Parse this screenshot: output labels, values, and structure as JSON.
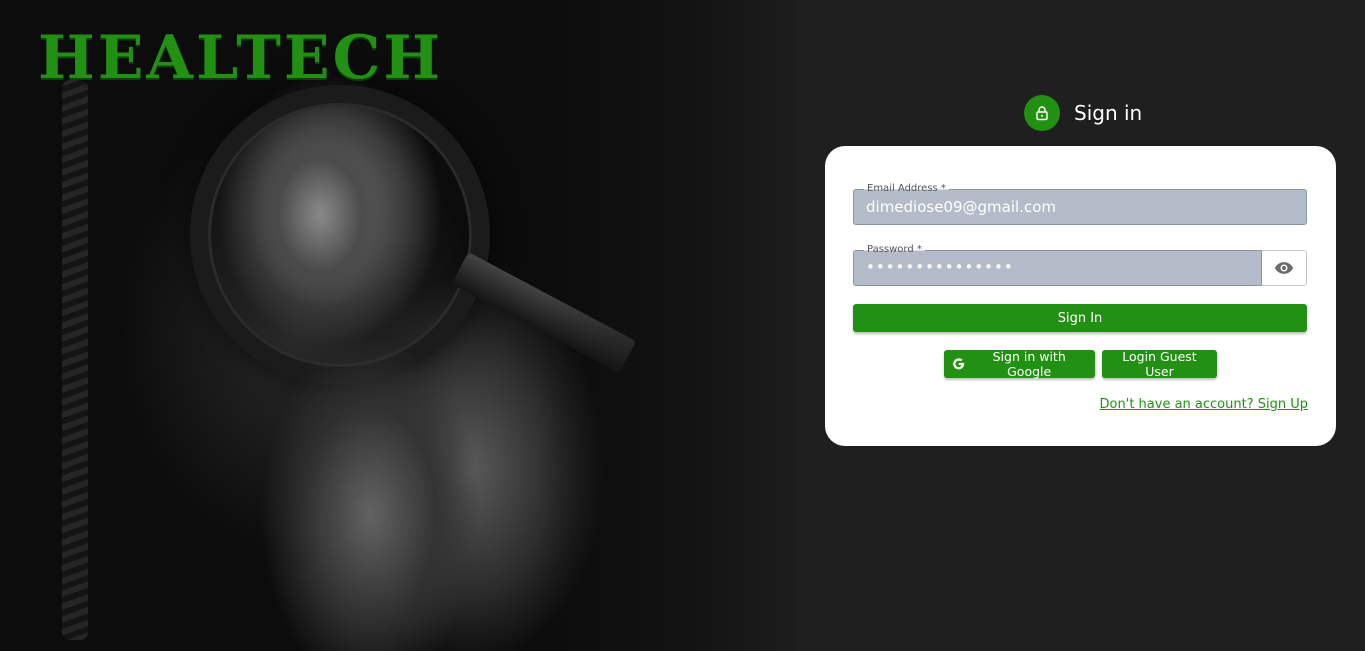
{
  "brand": {
    "name": "HEALTECH",
    "color": "#229113"
  },
  "auth": {
    "title": "Sign in",
    "icon": "lock-icon",
    "email": {
      "label": "Email Address *",
      "value": "dimediose09@gmail.com"
    },
    "password": {
      "label": "Password *",
      "value": "•••••••••••••••",
      "toggle_icon": "eye-icon"
    },
    "sign_in_label": "Sign In",
    "google_label": "Sign in with Google",
    "guest_label": "Login Guest User",
    "signup_link": "Don't have an account? Sign Up"
  },
  "colors": {
    "accent": "#229113",
    "field_bg": "#b4bcc9",
    "panel_bg": "#1f1f1f"
  }
}
